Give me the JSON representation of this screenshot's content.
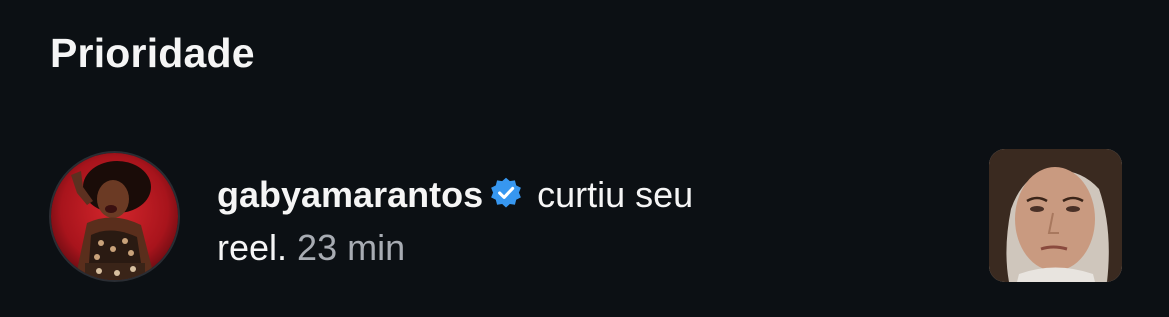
{
  "section": {
    "title": "Prioridade"
  },
  "notification": {
    "username": "gabyamarantos",
    "verified_icon": "verified-badge-icon",
    "action": "curtiu seu",
    "object": "reel.",
    "time": "23 min"
  },
  "colors": {
    "background": "#0c1014",
    "text": "#f5f5f5",
    "muted": "#a8acb3",
    "verified": "#3797f0"
  }
}
